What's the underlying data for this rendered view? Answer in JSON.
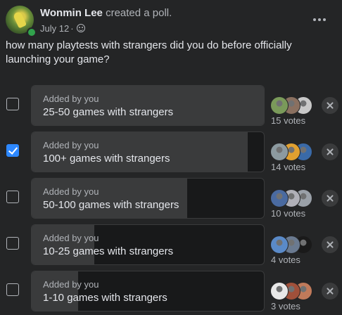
{
  "post": {
    "author": "Wonmin Lee",
    "action": "created a poll.",
    "date": "July 12",
    "separator": "·",
    "privacy_icon": "globe-icon",
    "more_icon": "more-options-icon"
  },
  "question": "how many playtests with strangers did you do before officially launching your game?",
  "poll": {
    "options": [
      {
        "added_by": "Added by you",
        "label": "25-50 games with strangers",
        "votes_text": "15 votes",
        "votes": 15,
        "fill_fraction": 1.0,
        "checked": false,
        "voter_colors": [
          "#7a9a5a",
          "#8a7060",
          "#c8c8c8"
        ]
      },
      {
        "added_by": "Added by you",
        "label": "100+ games with strangers",
        "votes_text": "14 votes",
        "votes": 14,
        "fill_fraction": 0.93,
        "checked": true,
        "voter_colors": [
          "#8c9aa0",
          "#e0a030",
          "#3a6aa8"
        ]
      },
      {
        "added_by": "Added by you",
        "label": "50-100 games with strangers",
        "votes_text": "10 votes",
        "votes": 10,
        "fill_fraction": 0.67,
        "checked": false,
        "voter_colors": [
          "#4a6aa0",
          "#b0b0b8",
          "#9aa0a8"
        ]
      },
      {
        "added_by": "Added by you",
        "label": "10-25 games with strangers",
        "votes_text": "4 votes",
        "votes": 4,
        "fill_fraction": 0.27,
        "checked": false,
        "voter_colors": [
          "#5a8ac8",
          "#6a7a90",
          "#1a1a1a"
        ]
      },
      {
        "added_by": "Added by you",
        "label": "1-10 games with strangers",
        "votes_text": "3 votes",
        "votes": 3,
        "fill_fraction": 0.2,
        "checked": false,
        "voter_colors": [
          "#e8e8e8",
          "#a0503a",
          "#c07a5a"
        ]
      }
    ]
  },
  "colors": {
    "background": "#242526",
    "bar_fill": "#3a3b3c",
    "bar_background": "#18191a",
    "accent": "#2d88ff",
    "online": "#31a24c",
    "text_primary": "#e4e6eb",
    "text_secondary": "#b0b3b8"
  }
}
